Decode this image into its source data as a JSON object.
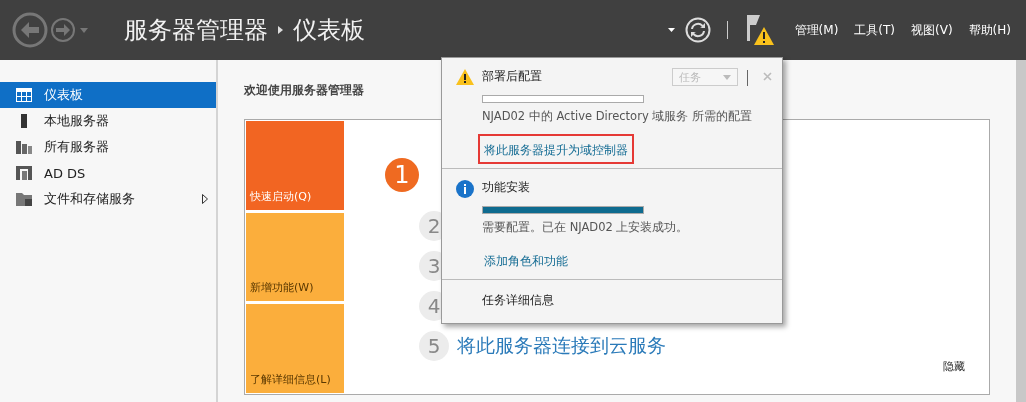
{
  "titlebar": {
    "breadcrumb": [
      "服务器管理器",
      "仪表板"
    ],
    "menus": [
      "管理(M)",
      "工具(T)",
      "视图(V)",
      "帮助(H)"
    ],
    "notification_warning": true
  },
  "sidebar": {
    "items": [
      {
        "label": "仪表板",
        "kind": "dashboard",
        "selected": true,
        "expandable": false
      },
      {
        "label": "本地服务器",
        "kind": "server",
        "selected": false,
        "expandable": false
      },
      {
        "label": "所有服务器",
        "kind": "servers",
        "selected": false,
        "expandable": false
      },
      {
        "label": "AD DS",
        "kind": "adds",
        "selected": false,
        "expandable": false
      },
      {
        "label": "文件和存储服务",
        "kind": "files",
        "selected": false,
        "expandable": true
      }
    ]
  },
  "main": {
    "heading": "欢迎使用服务器管理器",
    "tiles": [
      {
        "label": "快速启动(Q)",
        "selected": true
      },
      {
        "label": "新增功能(W)",
        "selected": false
      },
      {
        "label": "了解详细信息(L)",
        "selected": false
      }
    ],
    "steps": [
      {
        "number": "1",
        "current": true
      },
      {
        "number": "2",
        "current": false
      },
      {
        "number": "3",
        "current": false
      },
      {
        "number": "4",
        "current": false
      },
      {
        "number": "5",
        "label": "将此服务器连接到云服务",
        "current": false
      }
    ],
    "hide": "隐藏"
  },
  "popup": {
    "tasks_dropdown": {
      "label": "任务",
      "disabled": true
    },
    "sections": [
      {
        "kind": "warning",
        "title": "部署后配置",
        "level": 0,
        "description": "NJAD02 中的 Active Directory 域服务 所需的配置",
        "link": "将此服务器提升为域控制器",
        "highlighted": true
      },
      {
        "kind": "info",
        "title": "功能安装",
        "level": 1,
        "description": "需要配置。已在 NJAD02 上安装成功。",
        "link": "添加角色和功能",
        "highlighted": false
      }
    ],
    "footer": "任务详细信息"
  }
}
